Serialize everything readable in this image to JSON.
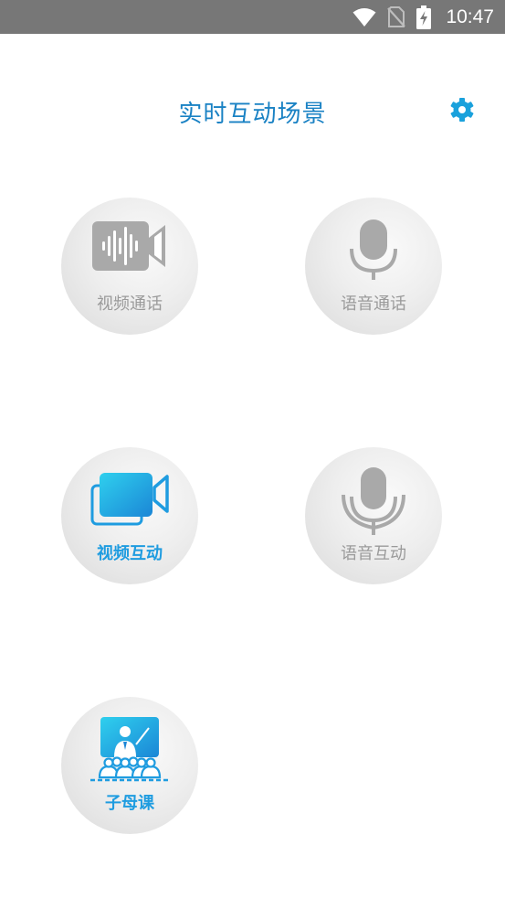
{
  "status_bar": {
    "time": "10:47",
    "icons": [
      "wifi-icon",
      "no-sim-icon",
      "battery-charging-icon"
    ]
  },
  "header": {
    "title": "实时互动场景",
    "settings_icon": "gear-icon"
  },
  "scenes": [
    {
      "label": "视频通话",
      "icon": "video-camera-waveform-icon",
      "active": false
    },
    {
      "label": "语音通话",
      "icon": "microphone-icon",
      "active": false
    },
    {
      "label": "视频互动",
      "icon": "video-camera-stack-icon",
      "active": true
    },
    {
      "label": "语音互动",
      "icon": "microphone-waves-icon",
      "active": false
    },
    {
      "label": "子母课",
      "icon": "classroom-teacher-icon",
      "active": true
    }
  ],
  "colors": {
    "accent": "#1a82c4",
    "active_label": "#1f9ce0",
    "inactive": "#9a9a9a",
    "status_bar": "#777777"
  }
}
